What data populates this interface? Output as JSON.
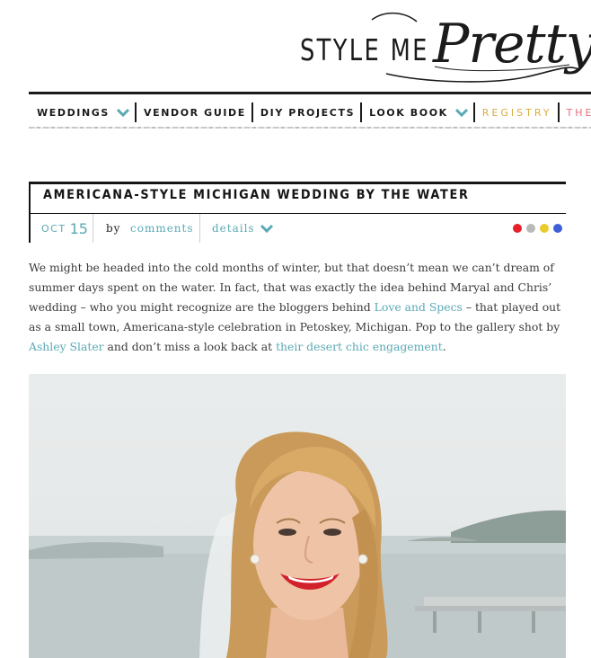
{
  "brand": {
    "logo_style": "STYLE ME",
    "logo_pretty": "Pretty"
  },
  "nav": {
    "items": [
      {
        "label": "WEDDINGS",
        "has_chevron": true
      },
      {
        "label": "VENDOR GUIDE",
        "has_chevron": false
      },
      {
        "label": "DIY PROJECTS",
        "has_chevron": false
      },
      {
        "label": "LOOK BOOK",
        "has_chevron": true
      },
      {
        "label": "REGISTRY",
        "has_chevron": false
      },
      {
        "label": "THE VAUL",
        "has_chevron": false
      }
    ],
    "colors": {
      "default": "#1b1b1b",
      "chevron": "#5aa9b5",
      "registry": "#d9ad3a",
      "vault": "#e56d7b"
    }
  },
  "post": {
    "title": "AMERICANA-STYLE MICHIGAN WEDDING BY THE WATER",
    "date_month": "OCT",
    "date_day": "15",
    "by_label": "by",
    "comments_label": "comments",
    "details_label": "details",
    "color_dots": [
      "#e8202a",
      "#b9b9b9",
      "#e9cc2b",
      "#3f5fd9"
    ],
    "body": {
      "p1": "We might be headed into the cold months of winter, but that doesn’t mean we can’t dream of summer days spent on the water. In fact, that was exactly the idea behind Maryal and Chris’ wedding – who you might recognize are the bloggers behind ",
      "link1": "Love and Specs",
      "p2": " – that played out as a small town, Americana-style celebration in Petoskey, Michigan. Pop to the gallery shot by ",
      "link2": "Ashley Slater",
      "p3": " and don’t miss a look back at ",
      "link3": "their desert chic engagement",
      "p4": "."
    }
  },
  "accent_color": "#5aa9b5"
}
